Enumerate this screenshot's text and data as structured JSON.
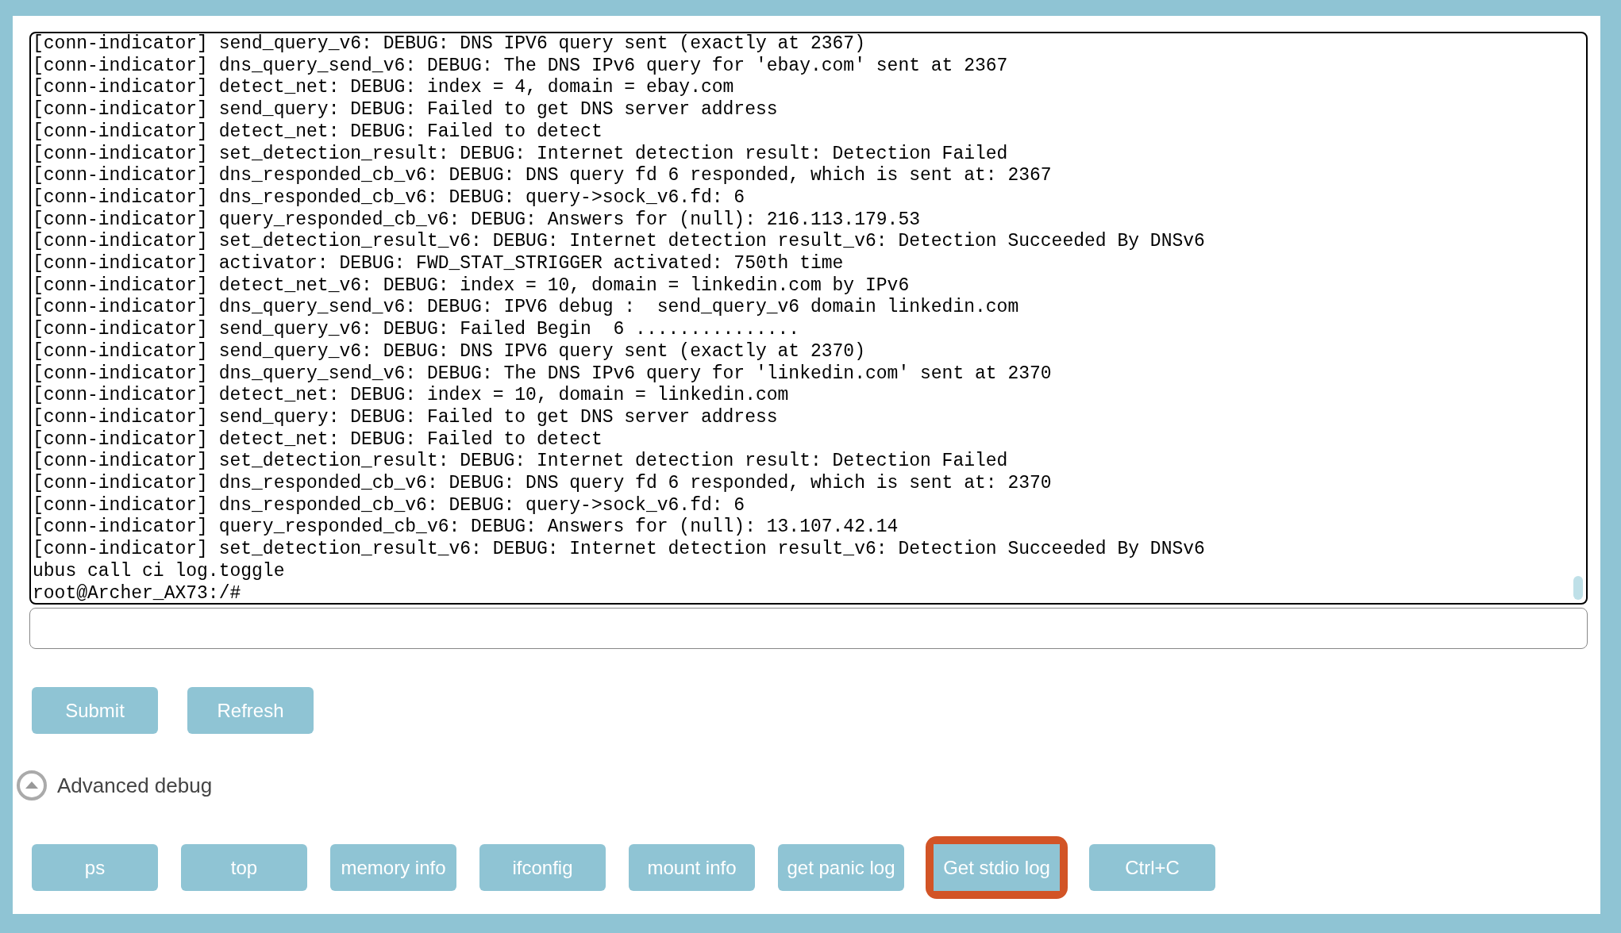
{
  "console": {
    "lines": [
      "[conn-indicator] send_query_v6: DEBUG: DNS IPV6 query sent (exactly at 2367)",
      "[conn-indicator] dns_query_send_v6: DEBUG: The DNS IPv6 query for 'ebay.com' sent at 2367",
      "[conn-indicator] detect_net: DEBUG: index = 4, domain = ebay.com",
      "[conn-indicator] send_query: DEBUG: Failed to get DNS server address",
      "[conn-indicator] detect_net: DEBUG: Failed to detect",
      "[conn-indicator] set_detection_result: DEBUG: Internet detection result: Detection Failed",
      "[conn-indicator] dns_responded_cb_v6: DEBUG: DNS query fd 6 responded, which is sent at: 2367",
      "[conn-indicator] dns_responded_cb_v6: DEBUG: query->sock_v6.fd: 6",
      "[conn-indicator] query_responded_cb_v6: DEBUG: Answers for (null): 216.113.179.53",
      "[conn-indicator] set_detection_result_v6: DEBUG: Internet detection result_v6: Detection Succeeded By DNSv6",
      "[conn-indicator] activator: DEBUG: FWD_STAT_STRIGGER activated: 750th time",
      "[conn-indicator] detect_net_v6: DEBUG: index = 10, domain = linkedin.com by IPv6",
      "[conn-indicator] dns_query_send_v6: DEBUG: IPV6 debug :  send_query_v6 domain linkedin.com",
      "[conn-indicator] send_query_v6: DEBUG: Failed Begin  6 ...............",
      "[conn-indicator] send_query_v6: DEBUG: DNS IPV6 query sent (exactly at 2370)",
      "[conn-indicator] dns_query_send_v6: DEBUG: The DNS IPv6 query for 'linkedin.com' sent at 2370",
      "[conn-indicator] detect_net: DEBUG: index = 10, domain = linkedin.com",
      "[conn-indicator] send_query: DEBUG: Failed to get DNS server address",
      "[conn-indicator] detect_net: DEBUG: Failed to detect",
      "[conn-indicator] set_detection_result: DEBUG: Internet detection result: Detection Failed",
      "[conn-indicator] dns_responded_cb_v6: DEBUG: DNS query fd 6 responded, which is sent at: 2370",
      "[conn-indicator] dns_responded_cb_v6: DEBUG: query->sock_v6.fd: 6",
      "[conn-indicator] query_responded_cb_v6: DEBUG: Answers for (null): 13.107.42.14",
      "[conn-indicator] set_detection_result_v6: DEBUG: Internet detection result_v6: Detection Succeeded By DNSv6",
      "ubus call ci log.toggle",
      "root@Archer_AX73:/#"
    ]
  },
  "command_buttons": [
    {
      "label": "Submit"
    },
    {
      "label": "Refresh"
    }
  ],
  "advanced_debug": {
    "label": "Advanced debug",
    "expanded": true
  },
  "debug_buttons": [
    {
      "label": "ps",
      "highlighted": false
    },
    {
      "label": "top",
      "highlighted": false
    },
    {
      "label": "memory info",
      "highlighted": false
    },
    {
      "label": "ifconfig",
      "highlighted": false
    },
    {
      "label": "mount info",
      "highlighted": false
    },
    {
      "label": "get panic log",
      "highlighted": false
    },
    {
      "label": "Get stdio log",
      "highlighted": true
    },
    {
      "label": "Ctrl+C",
      "highlighted": false
    }
  ]
}
